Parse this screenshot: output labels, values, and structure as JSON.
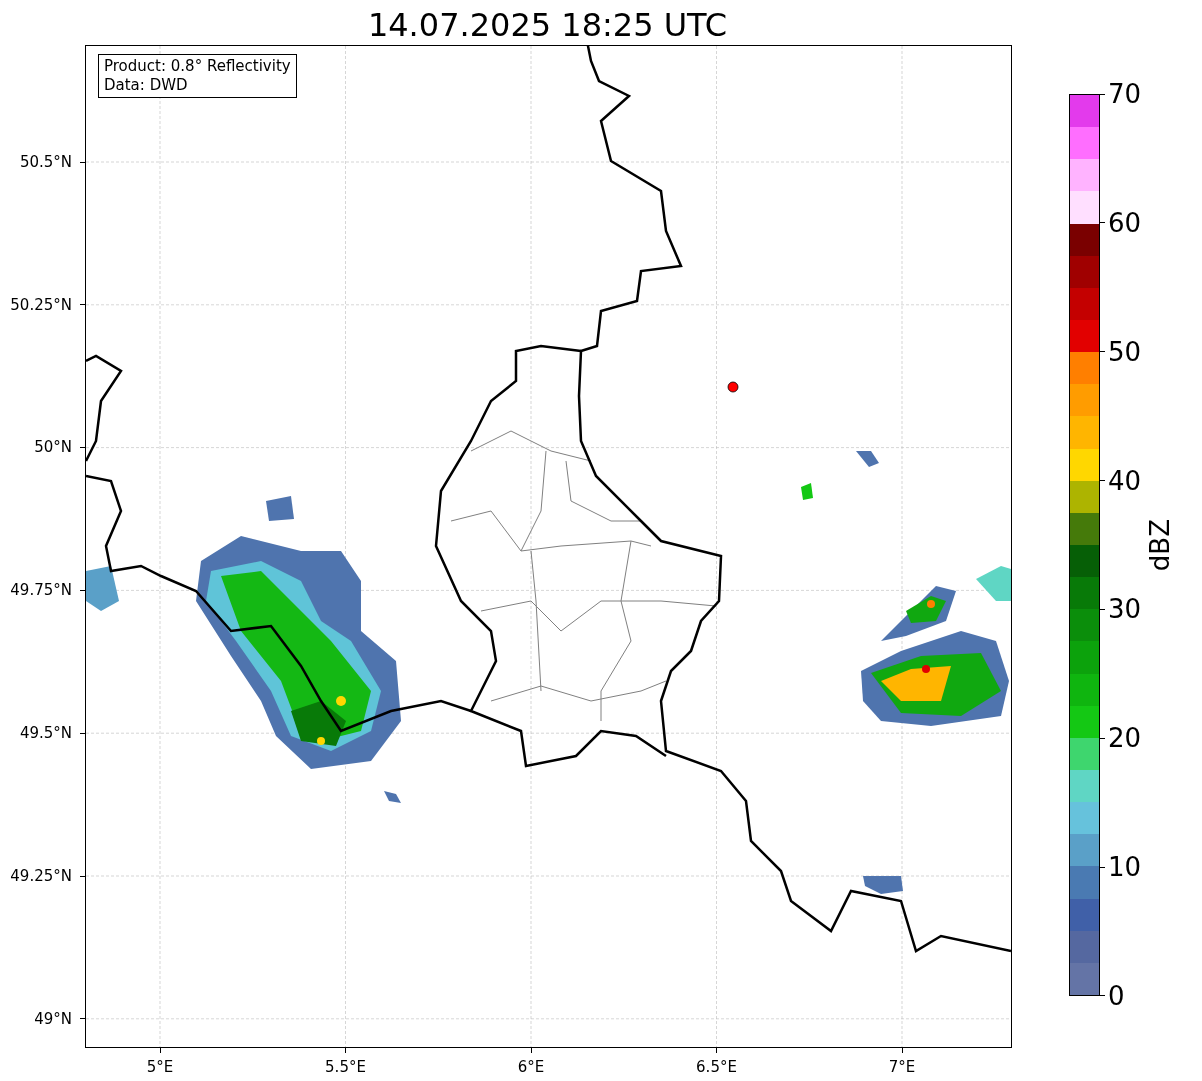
{
  "title": "14.07.2025 18:25 UTC",
  "info_box": {
    "lines": [
      "Product: 0.8° Reflectivity",
      "Data: DWD"
    ]
  },
  "map": {
    "yticks": [
      "50.5°N",
      "50.25°N",
      "50°N",
      "49.75°N",
      "49.5°N",
      "49.25°N",
      "49°N"
    ],
    "xticks": [
      "5°E",
      "5.5°E",
      "6°E",
      "6.5°E",
      "7°E"
    ]
  },
  "colorbar": {
    "label": "dBZ",
    "ticks": [
      "70",
      "60",
      "50",
      "40",
      "30",
      "20",
      "10",
      "0"
    ],
    "bins": [
      {
        "color": "#6474a6"
      },
      {
        "color": "#5568a0"
      },
      {
        "color": "#4060a8"
      },
      {
        "color": "#4a7ab2"
      },
      {
        "color": "#5aa0c8"
      },
      {
        "color": "#66c2dc"
      },
      {
        "color": "#5fd6c4"
      },
      {
        "color": "#3ed66e"
      },
      {
        "color": "#14c814"
      },
      {
        "color": "#0fb50f"
      },
      {
        "color": "#0ca20c"
      },
      {
        "color": "#0b8e0b"
      },
      {
        "color": "#087a08"
      },
      {
        "color": "#065f06"
      },
      {
        "color": "#457a0a"
      },
      {
        "color": "#adb400"
      },
      {
        "color": "#ffd700"
      },
      {
        "color": "#ffb500"
      },
      {
        "color": "#ff9c00"
      },
      {
        "color": "#ff7f00"
      },
      {
        "color": "#e20000"
      },
      {
        "color": "#c40000"
      },
      {
        "color": "#a00000"
      },
      {
        "color": "#7a0000"
      },
      {
        "color": "#ffdfff"
      },
      {
        "color": "#ffb3ff"
      },
      {
        "color": "#ff6eff"
      },
      {
        "color": "#e33aec"
      }
    ]
  }
}
